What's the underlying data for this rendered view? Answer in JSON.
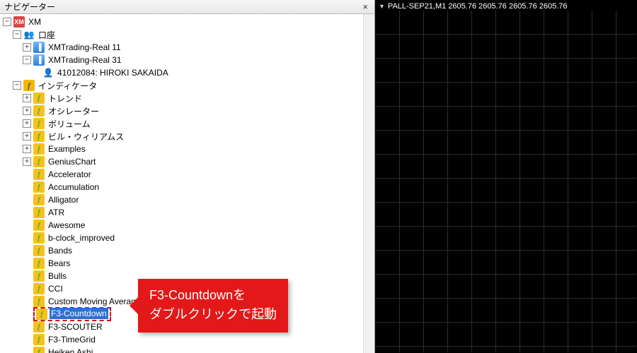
{
  "navigator": {
    "title": "ナビゲーター",
    "root": "XM",
    "accounts": {
      "label": "口座",
      "servers": [
        {
          "name": "XMTrading-Real 11"
        },
        {
          "name": "XMTrading-Real 31",
          "user": "41012084: HIROKI SAKAIDA"
        }
      ]
    },
    "indicators": {
      "label": "インディケータ",
      "folders": [
        "トレンド",
        "オシレーター",
        "ボリューム",
        "ビル・ウィリアムス",
        "Examples",
        "GeniusChart"
      ],
      "items": [
        "Accelerator",
        "Accumulation",
        "Alligator",
        "ATR",
        "Awesome",
        "b-clock_improved",
        "Bands",
        "Bears",
        "Bulls",
        "CCI",
        "Custom Moving Averages",
        "F3-Countdown",
        "F3-SCOUTER",
        "F3-TimeGrid",
        "Heiken Ashi"
      ],
      "selected": "F3-Countdown"
    }
  },
  "chart": {
    "symbol_line": "PALL-SEP21,M1 2605.76 2605.76 2605.76 2605.76"
  },
  "callout": {
    "line1": "F3-Countdownを",
    "line2": "ダブルクリックで起動"
  }
}
